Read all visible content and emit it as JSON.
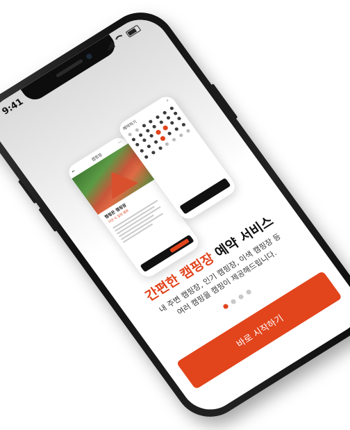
{
  "status_bar": {
    "time": "9:41"
  },
  "preview": {
    "card1": {
      "title": "캠핑장",
      "place_name": "캠핑온 캠핑장",
      "tag": "자연 속 힐링 캠핑"
    },
    "card2": {
      "title": "예약하기"
    }
  },
  "onboarding": {
    "headline_accent": "간편한 캠핑장",
    "headline_rest": " 예약 서비스",
    "description_line1": "내 주변 캠핑장, 인기 캠핑장, 이색 캠핑장 등",
    "description_line2": "여러 캠핑을 캠핑이 제공해드립니다.",
    "page_count": 4,
    "active_page": 1,
    "start_button": "바로 시작하기"
  },
  "colors": {
    "accent": "#e2441c",
    "phone_frame": "#111111"
  }
}
